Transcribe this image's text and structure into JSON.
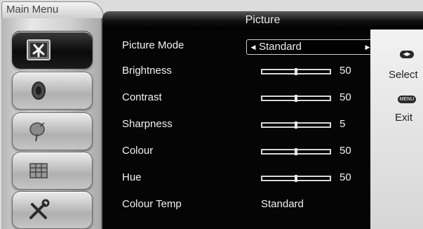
{
  "tab": {
    "label": "Main Menu"
  },
  "title": "Picture",
  "sidebar": {
    "items": [
      {
        "name": "picture",
        "icon": "picture-icon",
        "active": true
      },
      {
        "name": "sound",
        "icon": "speaker-icon",
        "active": false
      },
      {
        "name": "channel",
        "icon": "satellite-dish-icon",
        "active": false
      },
      {
        "name": "network",
        "icon": "network-icon",
        "active": false
      },
      {
        "name": "settings",
        "icon": "tools-icon",
        "active": false
      }
    ]
  },
  "menu": {
    "picture_mode": {
      "label": "Picture Mode",
      "value": "Standard"
    },
    "brightness": {
      "label": "Brightness",
      "value": "50",
      "level": 0.5
    },
    "contrast": {
      "label": "Contrast",
      "value": "50",
      "level": 0.5
    },
    "sharpness": {
      "label": "Sharpness",
      "value": "5",
      "level": 0.5
    },
    "colour": {
      "label": "Colour",
      "value": "50",
      "level": 0.5
    },
    "hue": {
      "label": "Hue",
      "value": "50",
      "level": 0.5
    },
    "colour_temp": {
      "label": "Colour Temp",
      "value": "Standard"
    }
  },
  "hints": {
    "select_label": "Select",
    "exit_key": "MENU",
    "exit_label": "Exit"
  }
}
